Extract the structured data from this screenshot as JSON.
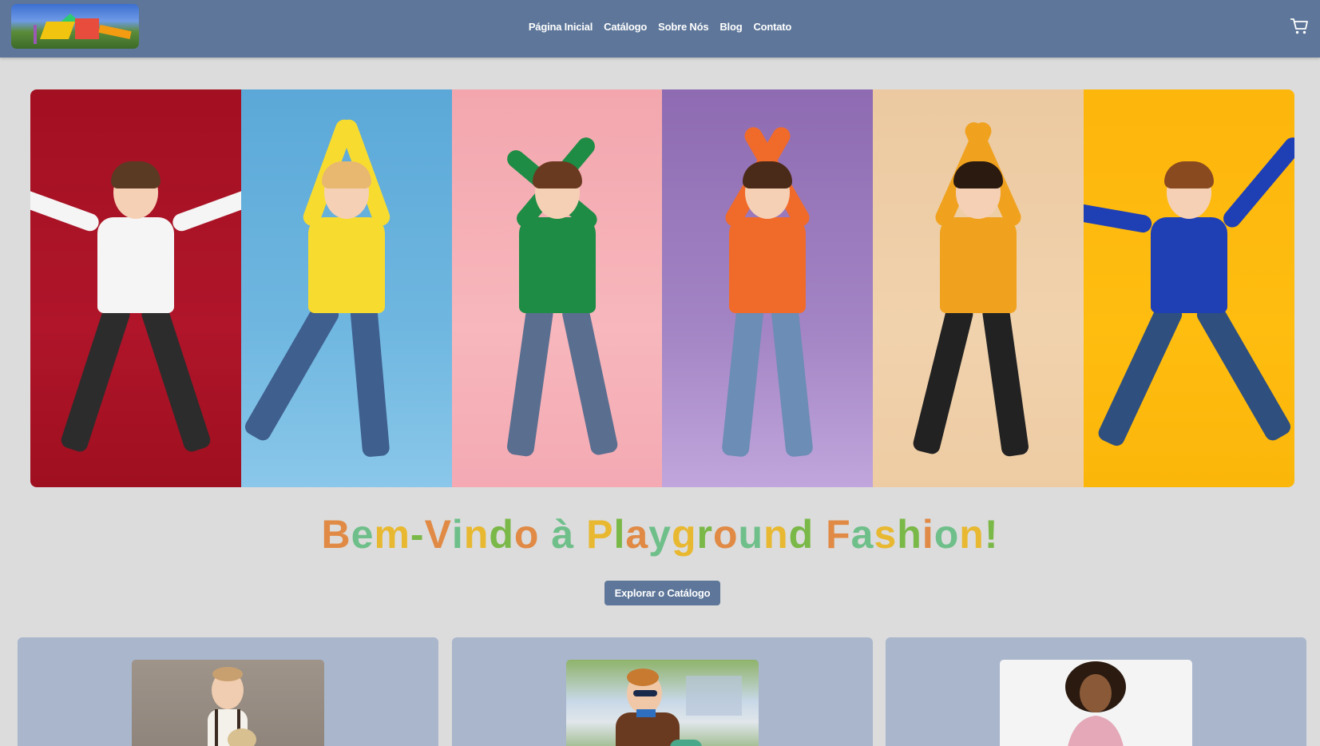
{
  "header": {
    "nav": [
      "Página Inicial",
      "Catálogo",
      "Sobre Nós",
      "Blog",
      "Contato"
    ]
  },
  "hero": {
    "panels": [
      {
        "bg": "#b0152a",
        "shirt": "#f5f5f5",
        "pants": "#2c2c2c",
        "hair": "#5a3a22"
      },
      {
        "bg": "#6fb7e0",
        "shirt": "#f7dc2f",
        "pants": "#3f5f8f",
        "hair": "#e8b870"
      },
      {
        "bg": "#f7b7bc",
        "shirt": "#1e8c45",
        "pants": "#5a6f90",
        "hair": "#6a3a20"
      },
      {
        "bg": "#a384c4",
        "shirt": "#f06a2a",
        "pants": "#6c8db5",
        "hair": "#4a2a18"
      },
      {
        "bg": "#f0d2ad",
        "shirt": "#f0a21f",
        "pants": "#222222",
        "hair": "#2a1a10"
      },
      {
        "bg": "#ffbd10",
        "shirt": "#1f3fb5",
        "pants": "#2f4f7f",
        "hair": "#8a4a20"
      }
    ]
  },
  "welcome": {
    "text": "Bem-Vindo à Playground Fashion!",
    "colors": [
      "#e08a45",
      "#6fbf8a",
      "#e8b830",
      "#7ab848"
    ]
  },
  "cta": {
    "label": "Explorar o Catálogo"
  },
  "colors": {
    "header": "#5d7699",
    "card": "#a9b6cb",
    "background": "#dcdcdc"
  },
  "icons": {
    "cart": "cart-icon"
  }
}
